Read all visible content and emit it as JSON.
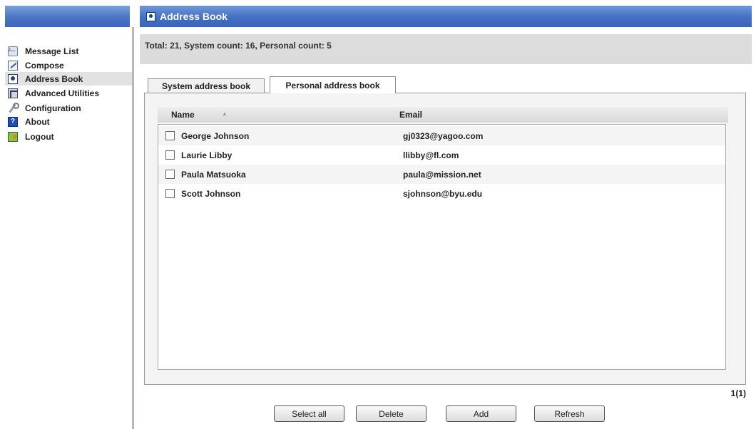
{
  "sidebar": {
    "items": [
      {
        "label": "Message List",
        "icon": "envelope-icon"
      },
      {
        "label": "Compose",
        "icon": "compose-icon"
      },
      {
        "label": "Address Book",
        "icon": "address-book-icon",
        "active": true
      },
      {
        "label": "Advanced Utilities",
        "icon": "utilities-icon"
      },
      {
        "label": "Configuration",
        "icon": "wrench-icon"
      },
      {
        "label": "About",
        "icon": "help-icon"
      },
      {
        "label": "Logout",
        "icon": "logout-icon"
      }
    ]
  },
  "header": {
    "title": "Address Book",
    "icon": "address-book-icon"
  },
  "summary": {
    "text": "Total: 21,  System count: 16,  Personal count:  5"
  },
  "tabs": [
    {
      "label": "System address book",
      "active": false
    },
    {
      "label": "Personal address book",
      "active": true
    }
  ],
  "table": {
    "columns": {
      "name": "Name",
      "email": "Email"
    },
    "sort_indicator": "▲",
    "rows": [
      {
        "name": "George Johnson",
        "email": "gj0323@yagoo.com"
      },
      {
        "name": "Laurie Libby",
        "email": "llibby@fl.com"
      },
      {
        "name": "Paula Matsuoka",
        "email": "paula@mission.net"
      },
      {
        "name": "Scott Johnson",
        "email": "sjohnson@byu.edu"
      }
    ]
  },
  "pager": {
    "text": "1(1)"
  },
  "buttons": {
    "select_all": "Select all",
    "delete": "Delete",
    "add": "Add",
    "refresh": "Refresh"
  },
  "colors": {
    "header_blue": "#4470c2",
    "active_nav": "#e2e2e2",
    "summary_bg": "#dcdcdc"
  }
}
